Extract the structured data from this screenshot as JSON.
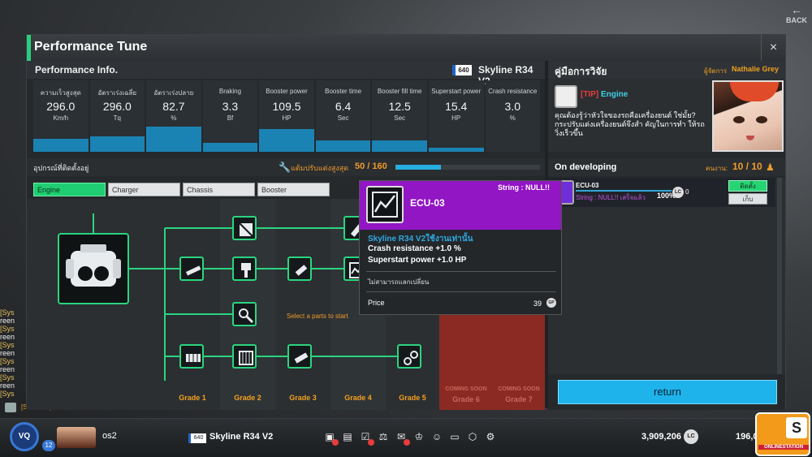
{
  "window": {
    "title": "Performance Tune",
    "close": "×"
  },
  "background": {
    "back_label": "BACK",
    "chat_tag": "[SERVER]"
  },
  "chat_lines": [
    "[Sys",
    "reen",
    "[Sys",
    "reen",
    "[Sys",
    "reen",
    "[Sys",
    "reen",
    "[Sys",
    "reen",
    "[Sys"
  ],
  "perf": {
    "header": "Performance Info.",
    "car_class": "640",
    "car_name": "Skyline R34 V2",
    "stats": [
      {
        "name": "ความเร็วสูงสุด",
        "value": "296.0",
        "unit": "Km/h",
        "fill": 0.18
      },
      {
        "name": "อัตราเร่งเฉลี่ย",
        "value": "296.0",
        "unit": "Tq",
        "fill": 0.22
      },
      {
        "name": "อัตราเร่งปลาย",
        "value": "82.7",
        "unit": "%",
        "fill": 0.35
      },
      {
        "name": "Braking",
        "value": "3.3",
        "unit": "Bf",
        "fill": 0.12
      },
      {
        "name": "Booster power",
        "value": "109.5",
        "unit": "HP",
        "fill": 0.32
      },
      {
        "name": "Booster time",
        "value": "6.4",
        "unit": "Sec",
        "fill": 0.16
      },
      {
        "name": "Booster fill time",
        "value": "12.5",
        "unit": "Sec",
        "fill": 0.16
      },
      {
        "name": "Superstart power",
        "value": "15.4",
        "unit": "HP",
        "fill": 0.06
      },
      {
        "name": "Crash resistance",
        "value": "3.0",
        "unit": "%",
        "fill": 0.0
      }
    ]
  },
  "equip": {
    "header": "อุปกรณ์ที่ติดตั้งอยู่",
    "points_label": "แต้มปรับแต่งสูงสุด",
    "points_value": "50 / 160",
    "points_fraction": 0.3125,
    "tabs": [
      "Engine",
      "Charger",
      "Chassis",
      "Booster"
    ],
    "select_hint": "Select a parts to start",
    "grades": [
      "Grade 1",
      "Grade 2",
      "Grade 3",
      "Grade 4",
      "Grade 5",
      "Grade 6",
      "Grade 7"
    ],
    "coming_soon": "COMING SOON",
    "node_levels": {
      "g2_top": "3",
      "g2_mid": "3",
      "g2_low": "2",
      "g1_mid": "2",
      "g1_bot": "2",
      "g2_bot": "2",
      "g3_mid": "3",
      "g3_bot": "2"
    }
  },
  "research": {
    "header": "คู่มือการวิจัย",
    "manager_label": "ผู้จัดการ",
    "manager_name": "Nathalie Grey",
    "tip_tag": "[TIP]",
    "tip_title": "Engine",
    "tip_text": "คุณต้องรู้ว่าหัวใจของรถคือเครื่องยนต์ ใช่มั้ย? กระปรับแต่งเครื่องยนต์จึงสำ คัญในการทำ ให้รถวิ่งเร็วขึ้น"
  },
  "developing": {
    "header": "On developing",
    "count_label": "คนงาน:",
    "count_value": "10 / 10",
    "item": {
      "name": "ECU-03",
      "status": "String : NULL!! เสร็จแล้ว",
      "percent": "100%",
      "lc_count": "0",
      "lc_label": "LC",
      "install_label": "ติดตั้ง",
      "store_label": "เก็บ"
    },
    "return_label": "return"
  },
  "tooltip": {
    "title": "ECU-03",
    "string": "String : NULL!!",
    "car_only": "Skyline R34 V2ใช้งานเท่านั้น",
    "line1": "Crash resistance +1.0 %",
    "line2": "Superstart power +1.0 HP",
    "note": "ไม่สามารถแลกเปลี่ยน",
    "price_label": "Price",
    "price_value": "39",
    "price_unit": "GP"
  },
  "hud": {
    "logo": "VQ",
    "level": "12",
    "player": "os2",
    "car_class": "640",
    "car_name": "Skyline R34 V2",
    "money": "3,909,206",
    "lc": "LC",
    "money2": "196,0",
    "station_logo": "S",
    "station_text": "ONLINESTATION"
  },
  "colors": {
    "accent": "#26d07c",
    "blue": "#1fb3ec",
    "orange": "#f09a2a",
    "purple": "#9216c4",
    "grade_locked": "#8b2a22"
  }
}
